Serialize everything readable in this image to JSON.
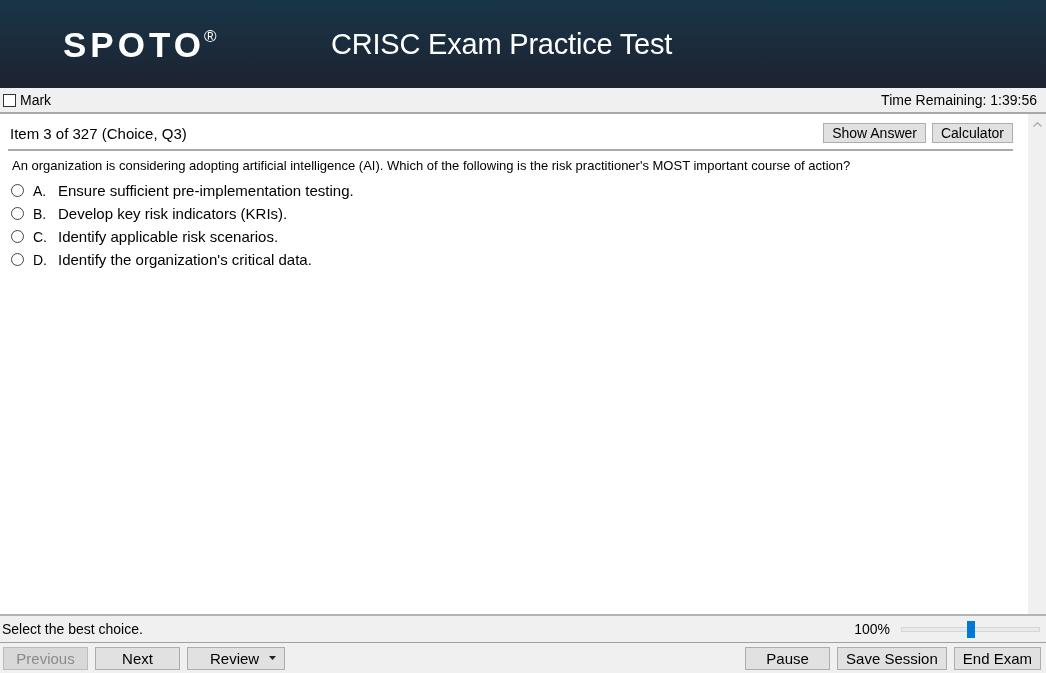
{
  "header": {
    "logo": "SPOTO$^{®}$",
    "title": "CRISC Exam Practice Test"
  },
  "mark_bar": {
    "mark": {
      "label": "Mark",
      "checked": false
    },
    "time_remaining": "Time Remaining: 1:39:56"
  },
  "item": {
    "heading": "Item 3 of 327 (Choice, Q3)",
    "buttons": [
      "Show Answer",
      "Calculator"
    ],
    "question": "An organization is considering adopting artificial intelligence (AI). Which of the following is the risk practitioner's MOST important course of action?",
    "options": [
      {
        "letter": "A.",
        "text": "Ensure sufficient pre-implementation testing.",
        "selected": false
      },
      {
        "letter": "B.",
        "text": "Develop key risk indicators (KRIs).",
        "selected": false
      },
      {
        "letter": "C.",
        "text": "Identify applicable risk scenarios.",
        "selected": false
      },
      {
        "letter": "D.",
        "text": "Identify the organization's critical data.",
        "selected": false
      }
    ]
  },
  "status_bar": {
    "instruction": "Select the best choice.",
    "zoom": {
      "reading": "100%",
      "level": 0.5
    }
  },
  "nav": {
    "left": [
      {
        "label": "Previous",
        "kind": "plain",
        "disabled": true
      },
      {
        "label": "Next",
        "kind": "plain",
        "disabled": false
      },
      {
        "label": "Review",
        "kind": "menu",
        "disabled": false
      }
    ],
    "right": [
      {
        "label": "Pause",
        "kind": "plain",
        "disabled": false
      },
      {
        "label": "Save Session",
        "kind": "plain",
        "disabled": false
      },
      {
        "label": "End Exam",
        "kind": "plain",
        "disabled": false
      }
    ]
  }
}
